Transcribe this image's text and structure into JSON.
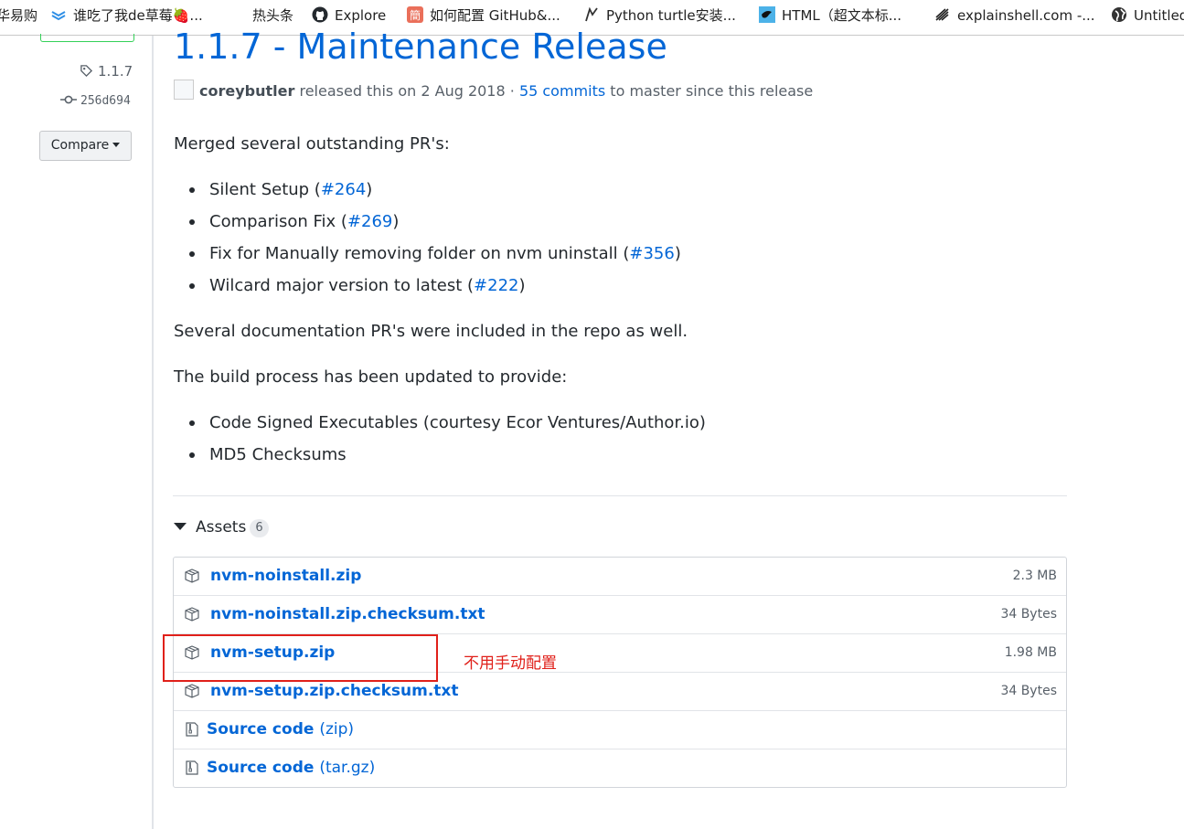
{
  "bookmarks": [
    {
      "label": "华易购",
      "icon": "none"
    },
    {
      "label": "谁吃了我de草莓🍓...",
      "icon": "layers-icon"
    },
    {
      "label": "热头条",
      "icon": "none"
    },
    {
      "label": "Explore",
      "icon": "github-icon"
    },
    {
      "label": "如何配置 GitHub&...",
      "icon": "jianshu-icon"
    },
    {
      "label": "Python turtle安装...",
      "icon": "turtle-icon"
    },
    {
      "label": "HTML（超文本标...",
      "icon": "bird-icon"
    },
    {
      "label": "explainshell.com -...",
      "icon": "shell-icon"
    },
    {
      "label": "Untitled",
      "icon": "globe-icon"
    }
  ],
  "sidebar": {
    "tag": "1.1.7",
    "commit": "256d694",
    "compare_label": "Compare"
  },
  "release": {
    "title": "1.1.7 - Maintenance Release",
    "author": "coreybutler",
    "released_text": "released this on 2 Aug 2018 ·",
    "commits_link": "55 commits",
    "since_text": "to master since this release",
    "intro": "Merged several outstanding PR's:",
    "prs": [
      {
        "text": "Silent Setup (",
        "link": "#264",
        "end": ")"
      },
      {
        "text": "Comparison Fix (",
        "link": "#269",
        "end": ")"
      },
      {
        "text": "Fix for Manually removing folder on nvm uninstall (",
        "link": "#356",
        "end": ")"
      },
      {
        "text": "Wilcard major version to latest (",
        "link": "#222",
        "end": ")"
      }
    ],
    "docs_text": "Several documentation PR's were included in the repo as well.",
    "build_text": "The build process has been updated to provide:",
    "build_items": [
      "Code Signed Executables (courtesy Ecor Ventures/Author.io)",
      "MD5 Checksums"
    ]
  },
  "assets": {
    "heading": "Assets",
    "count": "6",
    "files": [
      {
        "name": "nvm-noinstall.zip",
        "size": "2.3 MB"
      },
      {
        "name": "nvm-noinstall.zip.checksum.txt",
        "size": "34 Bytes"
      },
      {
        "name": "nvm-setup.zip",
        "size": "1.98 MB"
      },
      {
        "name": "nvm-setup.zip.checksum.txt",
        "size": "34 Bytes"
      }
    ],
    "sources": [
      {
        "name": "Source code",
        "ext": "(zip)"
      },
      {
        "name": "Source code",
        "ext": "(tar.gz)"
      }
    ]
  },
  "annotation": {
    "note": "不用手动配置",
    "color": "#e0201a"
  },
  "colors": {
    "link": "#0366d6",
    "text": "#24292e",
    "muted": "#586069"
  }
}
